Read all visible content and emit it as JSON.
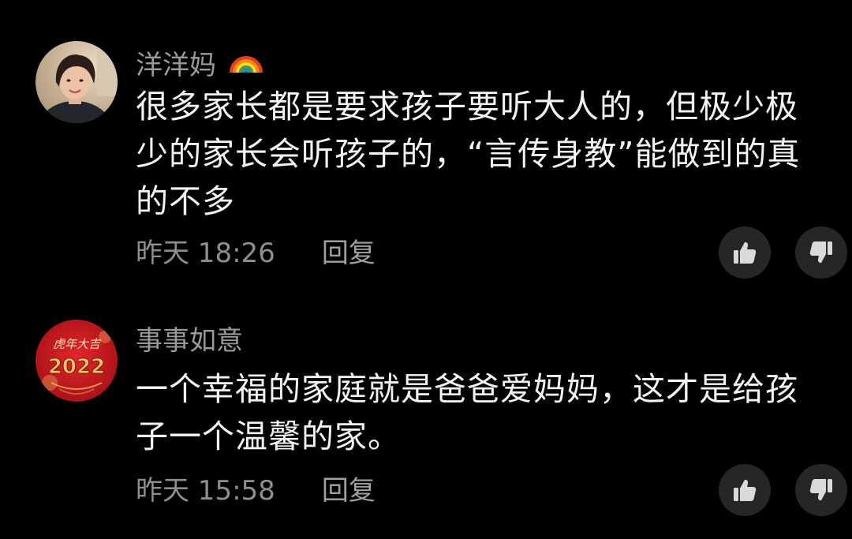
{
  "comments": [
    {
      "username": "洋洋妈",
      "username_emoji": "rainbow-icon",
      "lines": [
        "很多家长都是要求孩子要听大人的，但极少极",
        "少的家长会听孩子的，“言传身教”能做到的真",
        "的不多"
      ],
      "time": "昨天 18:26",
      "reply_label": "回复",
      "like_icon": "thumbs-up-icon",
      "dislike_icon": "thumbs-down-icon"
    },
    {
      "username": "事事如意",
      "avatar_text": {
        "top": "虎年大吉",
        "year": "2022"
      },
      "lines": [
        "一个幸福的家庭就是爸爸爱妈妈，这才是给孩",
        "子一个温馨的家。"
      ],
      "time": "昨天 15:58",
      "reply_label": "回复",
      "like_icon": "thumbs-up-icon",
      "dislike_icon": "thumbs-down-icon"
    }
  ],
  "colors": {
    "background": "#000000",
    "username": "#9a9a9a",
    "body_text": "#f4f4f4",
    "meta_text": "#8e8e8e",
    "vote_button_bg": "#262626",
    "avatar_2_red": "#c8161d",
    "avatar_2_gold": "#f3c66a"
  }
}
